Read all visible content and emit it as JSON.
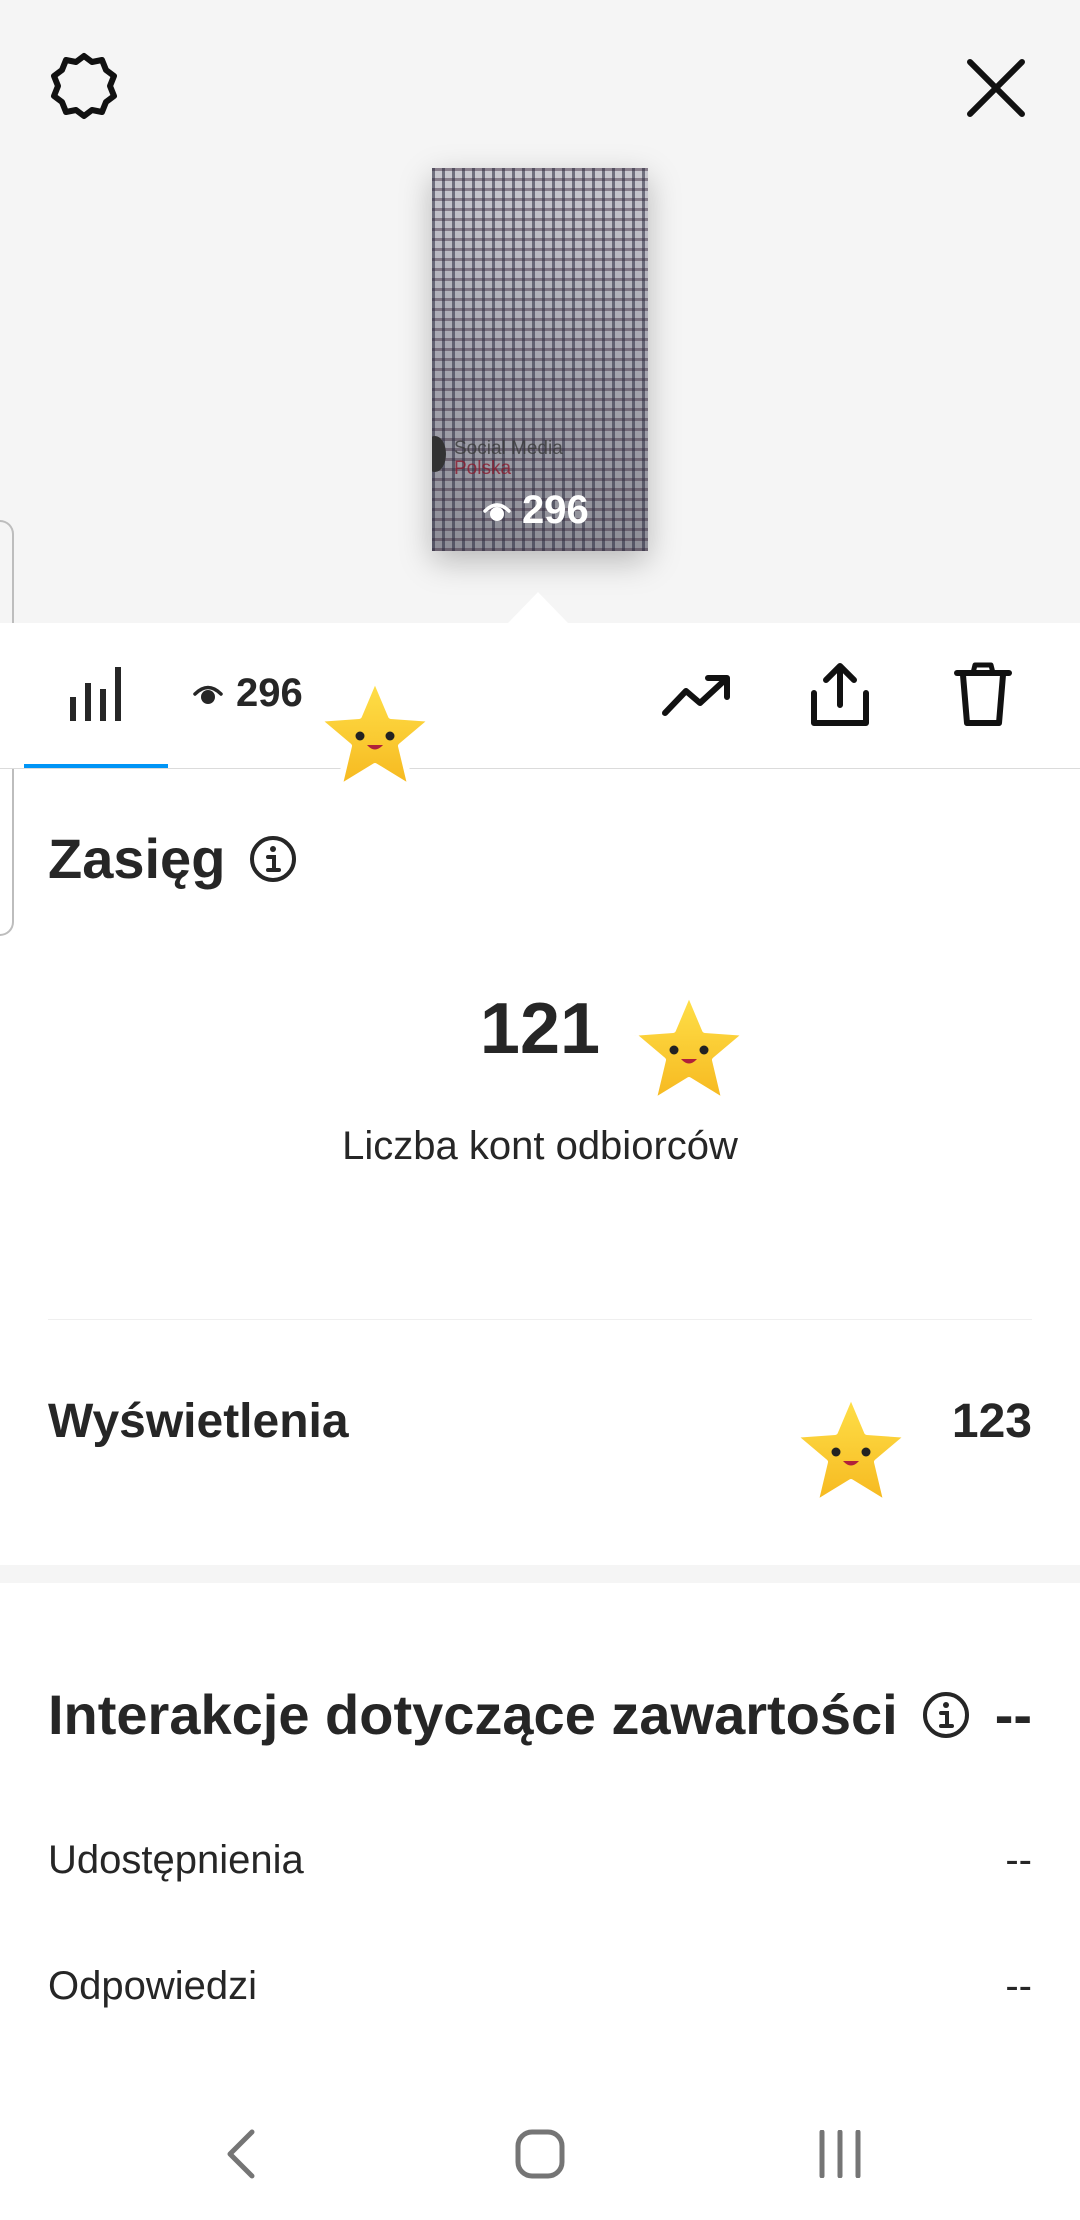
{
  "header": {
    "settings_icon": "gear-icon",
    "close_icon": "close-icon"
  },
  "thumbnail": {
    "brand_line1": "Social Media",
    "brand_line2": "Polska",
    "view_count": "296"
  },
  "toolbar": {
    "insights_tab_icon": "bar-chart-icon",
    "view_count": "296",
    "icons": [
      "trending-icon",
      "share-icon",
      "trash-icon"
    ],
    "accent": "#0095f6"
  },
  "reach": {
    "title": "Zasięg",
    "value": "121",
    "caption": "Liczba kont odbiorców"
  },
  "impressions": {
    "label": "Wyświetlenia",
    "value": "123"
  },
  "interactions": {
    "title": "Interakcje dotyczące zawartości",
    "title_value": "--",
    "rows": [
      {
        "label": "Udostępnienia",
        "value": "--"
      },
      {
        "label": "Odpowiedzi",
        "value": "--"
      }
    ]
  },
  "navbar": {
    "icons": [
      "back-icon",
      "home-icon",
      "recents-icon"
    ]
  }
}
